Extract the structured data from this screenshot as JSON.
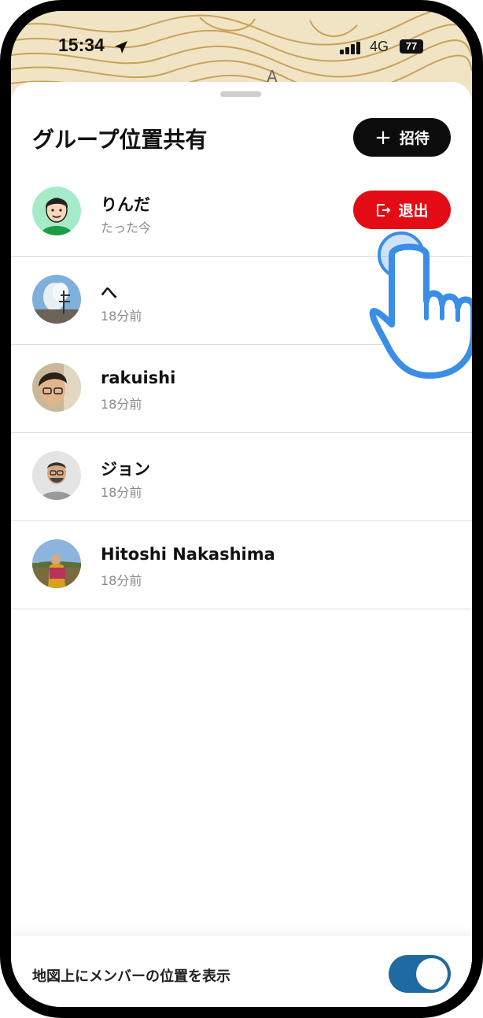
{
  "status_bar": {
    "time": "15:34",
    "network": "4G",
    "battery": "77"
  },
  "sheet": {
    "title": "グループ位置共有",
    "invite_label": "招待"
  },
  "members": [
    {
      "name": "りんだ",
      "time": "たった今",
      "leave_label": "退出"
    },
    {
      "name": "へ",
      "time": "18分前"
    },
    {
      "name": "rakuishi",
      "time": "18分前"
    },
    {
      "name": "ジョン",
      "time": "18分前"
    },
    {
      "name": "Hitoshi Nakashima",
      "time": "18分前"
    }
  ],
  "footer": {
    "label": "地図上にメンバーの位置を表示",
    "toggle_on": true
  },
  "colors": {
    "leave": "#e30c15",
    "toggle": "#1f6aa0",
    "hand": "#3a8ee6",
    "invite": "#0c0c0c"
  }
}
